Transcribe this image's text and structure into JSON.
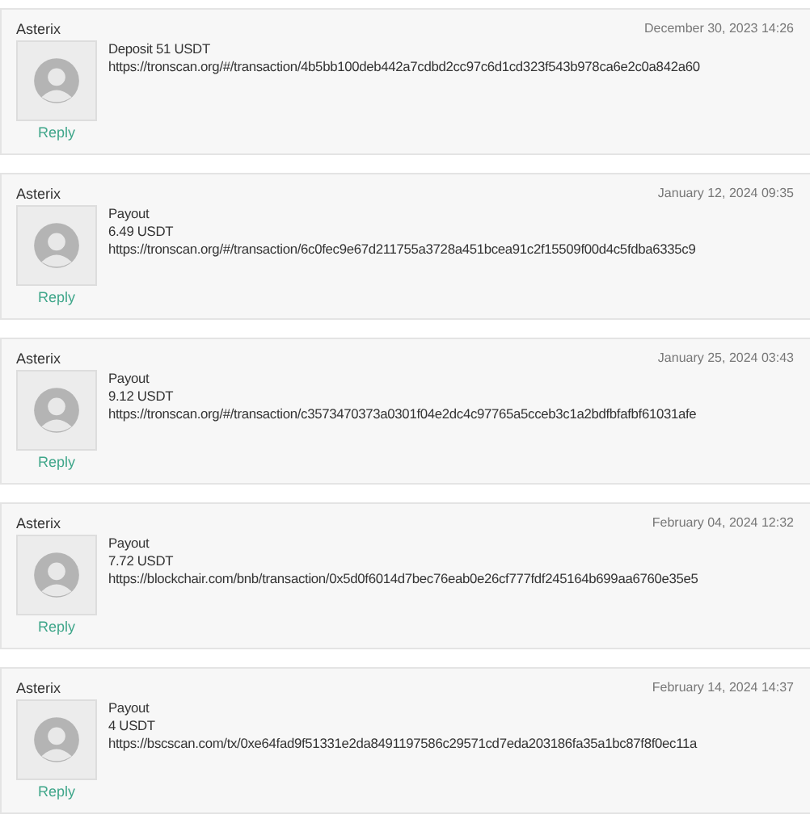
{
  "posts": [
    {
      "author": "Asterix",
      "date": "December 30, 2023 14:26",
      "lines": [
        "Deposit 51 USDT",
        "https://tronscan.org/#/transaction/4b5bb100deb442a7cdbd2cc97c6d1cd323f543b978ca6e2c0a842a60"
      ],
      "reply": "Reply"
    },
    {
      "author": "Asterix",
      "date": "January 12, 2024 09:35",
      "lines": [
        "Payout",
        "6.49 USDT",
        "https://tronscan.org/#/transaction/6c0fec9e67d211755a3728a451bcea91c2f15509f00d4c5fdba6335c9"
      ],
      "reply": "Reply"
    },
    {
      "author": "Asterix",
      "date": "January 25, 2024 03:43",
      "lines": [
        "Payout",
        "9.12 USDT",
        "https://tronscan.org/#/transaction/c3573470373a0301f04e2dc4c97765a5cceb3c1a2bdfbfafbf61031afe"
      ],
      "reply": "Reply"
    },
    {
      "author": "Asterix",
      "date": "February 04, 2024 12:32",
      "lines": [
        "Payout",
        "7.72 USDT",
        "https://blockchair.com/bnb/transaction/0x5d0f6014d7bec76eab0e26cf777fdf245164b699aa6760e35e5"
      ],
      "reply": "Reply"
    },
    {
      "author": "Asterix",
      "date": "February 14, 2024 14:37",
      "lines": [
        "Payout",
        "4 USDT",
        "https://bscscan.com/tx/0xe64fad9f51331e2da8491197586c29571cd7eda203186fa35a1bc87f8f0ec11a"
      ],
      "reply": "Reply"
    }
  ]
}
